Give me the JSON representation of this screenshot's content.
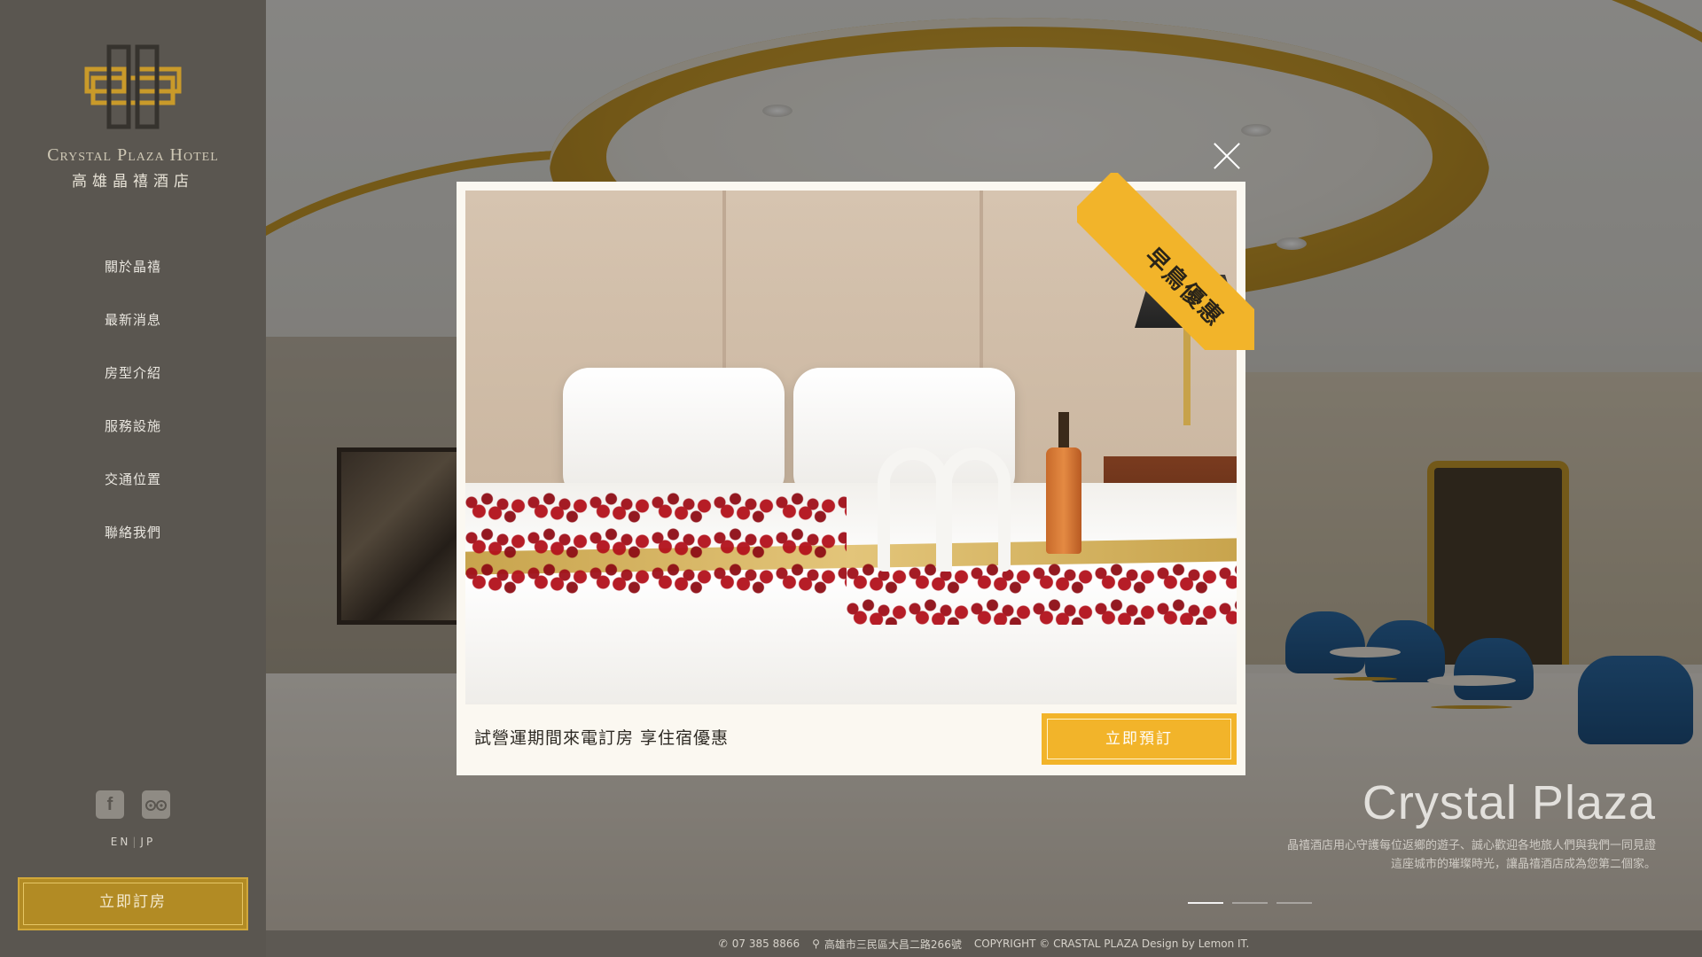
{
  "brand": {
    "name_en": "Crystal Plaza Hotel",
    "name_zh": "高雄晶禧酒店"
  },
  "nav": [
    {
      "label": "關於晶禧"
    },
    {
      "label": "最新消息"
    },
    {
      "label": "房型介紹"
    },
    {
      "label": "服務設施"
    },
    {
      "label": "交通位置"
    },
    {
      "label": "聯絡我們"
    }
  ],
  "social": {
    "facebook_icon": "facebook-icon",
    "tripadvisor_icon": "tripadvisor-icon"
  },
  "lang": {
    "en": "EN",
    "jp": "JP"
  },
  "sidebar_book_label": "立即訂房",
  "hero": {
    "title": "Crystal Plaza",
    "desc_line1": "晶禧酒店用心守護每位返鄉的遊子、誠心歡迎各地旅人們與我們一同見證",
    "desc_line2": "這座城市的璀璨時光，讓晶禧酒店成為您第二個家。"
  },
  "modal": {
    "ribbon": "早鳥優惠",
    "text": "試營運期間來電訂房 享住宿優惠",
    "button": "立即預訂"
  },
  "footer": {
    "phone": "07 385 8866",
    "address": "高雄市三民區大昌二路266號",
    "copyright": "COPYRIGHT © CRASTAL PLAZA Design by Lemon IT."
  },
  "colors": {
    "accent_gold": "#f2b42a",
    "sidebar_bg": "#5a5650",
    "sidebar_button": "#b28b24"
  }
}
